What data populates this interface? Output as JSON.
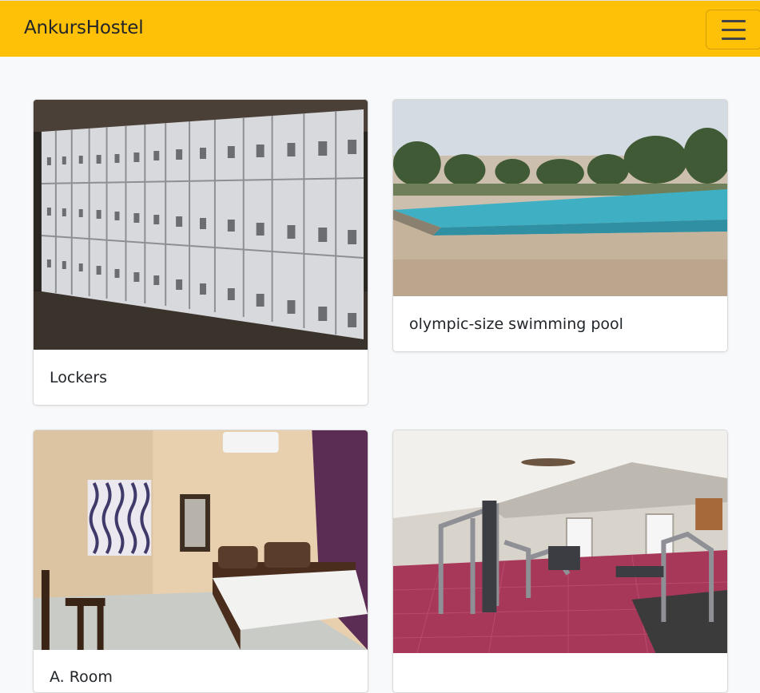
{
  "navbar": {
    "brand": "AnkursHostel",
    "toggle_icon": "hamburger-menu-icon"
  },
  "cards": [
    {
      "title": "Lockers",
      "image": "lockers-photo"
    },
    {
      "title": "olympic-size swimming pool",
      "image": "swimming-pool-photo"
    },
    {
      "title": "A. Room",
      "image": "hostel-room-photo"
    },
    {
      "title": "",
      "image": "gym-photo"
    }
  ],
  "colors": {
    "navbar": "#ffc107",
    "page_background": "#f8f9fa",
    "card_background": "#ffffff"
  }
}
